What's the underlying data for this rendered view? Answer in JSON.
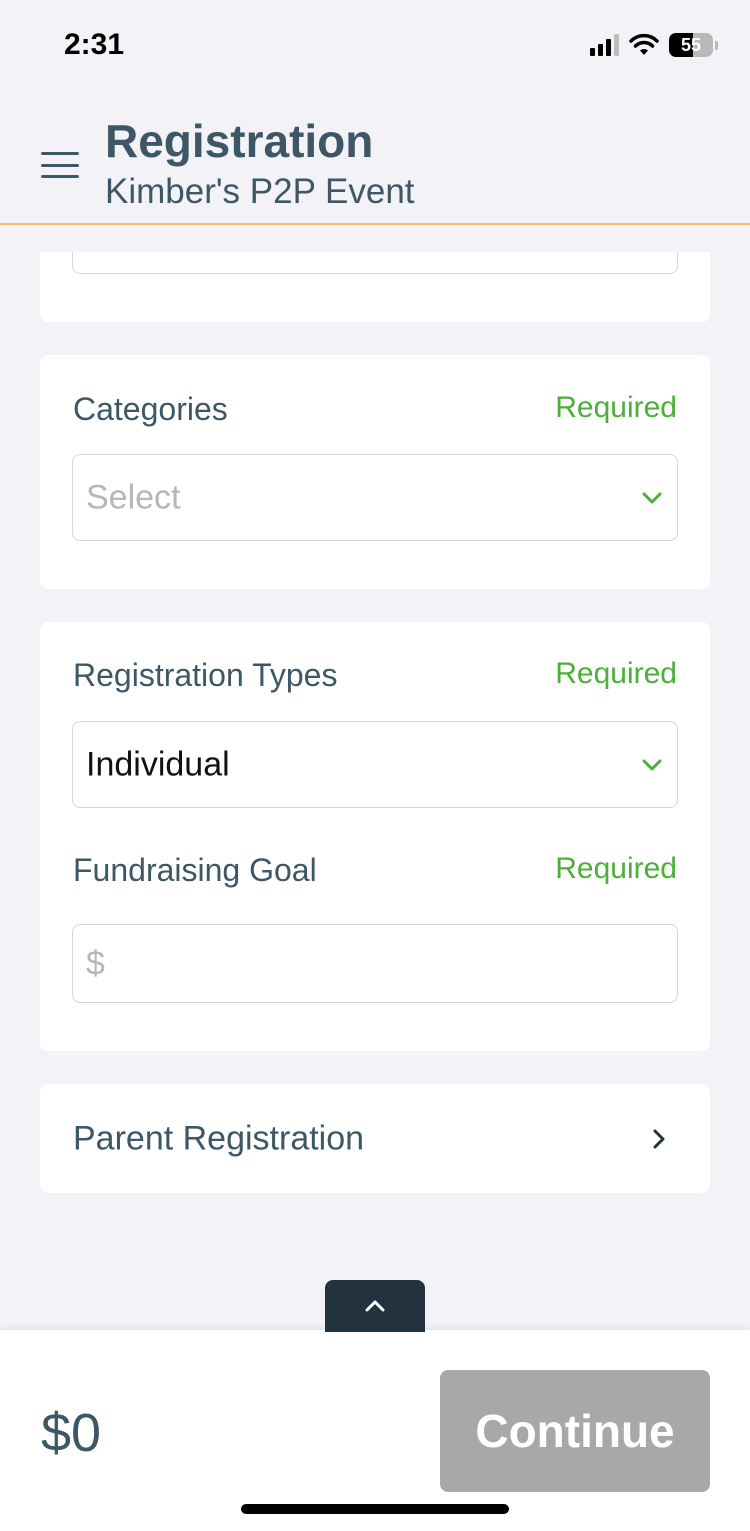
{
  "status_bar": {
    "time": "2:31",
    "battery": "55"
  },
  "header": {
    "title": "Registration",
    "subtitle": "Kimber's P2P Event"
  },
  "categories": {
    "label": "Categories",
    "required": "Required",
    "placeholder": "Select"
  },
  "registration_types": {
    "label": "Registration Types",
    "required": "Required",
    "value": "Individual"
  },
  "fundraising_goal": {
    "label": "Fundraising Goal",
    "required": "Required",
    "placeholder": "$"
  },
  "parent_registration": {
    "label": "Parent Registration"
  },
  "footer": {
    "total": "$0",
    "continue_label": "Continue"
  },
  "colors": {
    "accent_green": "#4caf3a",
    "header_divider": "#f5c26b",
    "text_primary": "#3e5766",
    "button_disabled": "#a8a8a8"
  },
  "icons": [
    "menu-icon",
    "chevron-down-icon",
    "chevron-right-icon",
    "chevron-up-icon",
    "wifi-icon",
    "signal-icon",
    "battery-icon"
  ]
}
